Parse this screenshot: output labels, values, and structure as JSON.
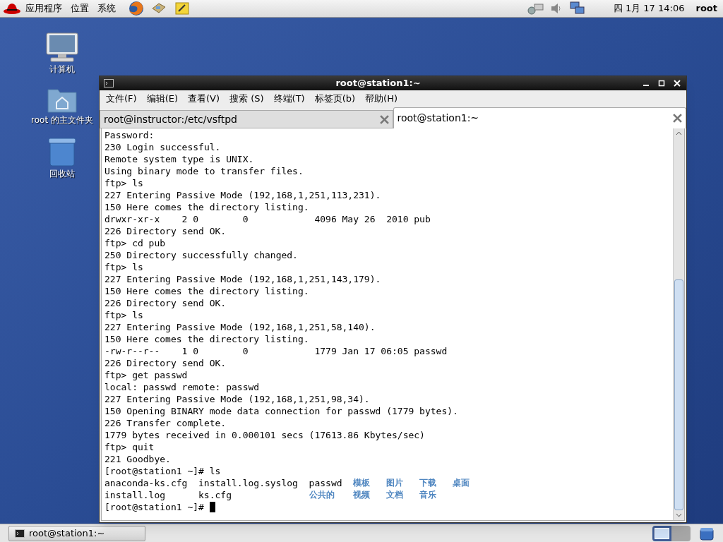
{
  "top_panel": {
    "menus": [
      "应用程序",
      "位置",
      "系统"
    ],
    "clock": "四 1月 17 14:06",
    "user": "root"
  },
  "desktop_icons": [
    {
      "label": "计算机",
      "kind": "computer"
    },
    {
      "label": "root 的主文件夹",
      "kind": "home"
    },
    {
      "label": "回收站",
      "kind": "trash"
    }
  ],
  "window": {
    "title": "root@station1:~",
    "menu": [
      "文件(F)",
      "编辑(E)",
      "查看(V)",
      "搜索 (S)",
      "终端(T)",
      "标签页(b)",
      "帮助(H)"
    ],
    "tabs": [
      {
        "label": "root@instructor:/etc/vsftpd",
        "selected": false
      },
      {
        "label": "root@station1:~",
        "selected": true
      }
    ],
    "terminal": {
      "lines": [
        "Password:",
        "230 Login successful.",
        "Remote system type is UNIX.",
        "Using binary mode to transfer files.",
        "ftp> ls",
        "227 Entering Passive Mode (192,168,1,251,113,231).",
        "150 Here comes the directory listing.",
        "drwxr-xr-x    2 0        0            4096 May 26  2010 pub",
        "226 Directory send OK.",
        "ftp> cd pub",
        "250 Directory successfully changed.",
        "ftp> ls",
        "227 Entering Passive Mode (192,168,1,251,143,179).",
        "150 Here comes the directory listing.",
        "226 Directory send OK.",
        "ftp> ls",
        "227 Entering Passive Mode (192,168,1,251,58,140).",
        "150 Here comes the directory listing.",
        "-rw-r--r--    1 0        0            1779 Jan 17 06:05 passwd",
        "226 Directory send OK.",
        "ftp> get passwd",
        "local: passwd remote: passwd",
        "227 Entering Passive Mode (192,168,1,251,98,34).",
        "150 Opening BINARY mode data connection for passwd (1779 bytes).",
        "226 Transfer complete.",
        "1779 bytes received in 0.000101 secs (17613.86 Kbytes/sec)",
        "ftp> quit",
        "221 Goodbye.",
        "[root@station1 ~]# ls"
      ],
      "listing": [
        [
          {
            "name": "anaconda-ks.cfg",
            "kind": "file"
          },
          {
            "name": "install.log.syslog",
            "kind": "file"
          },
          {
            "name": "passwd",
            "kind": "file"
          },
          {
            "name": "模板",
            "kind": "dir"
          },
          {
            "name": "图片",
            "kind": "dir"
          },
          {
            "name": "下载",
            "kind": "dir"
          },
          {
            "name": "桌面",
            "kind": "dir"
          }
        ],
        [
          {
            "name": "install.log",
            "kind": "file"
          },
          {
            "name": "ks.cfg",
            "kind": "file"
          },
          {
            "name": "公共的",
            "kind": "dir"
          },
          {
            "name": "视频",
            "kind": "dir"
          },
          {
            "name": "文档",
            "kind": "dir"
          },
          {
            "name": "音乐",
            "kind": "dir"
          }
        ]
      ],
      "prompt": "[root@station1 ~]# "
    }
  },
  "taskbar": {
    "tasks": [
      {
        "label": "root@station1:~",
        "selected": false
      }
    ],
    "workspaces": [
      {
        "selected": true
      },
      {
        "selected": false
      }
    ]
  }
}
